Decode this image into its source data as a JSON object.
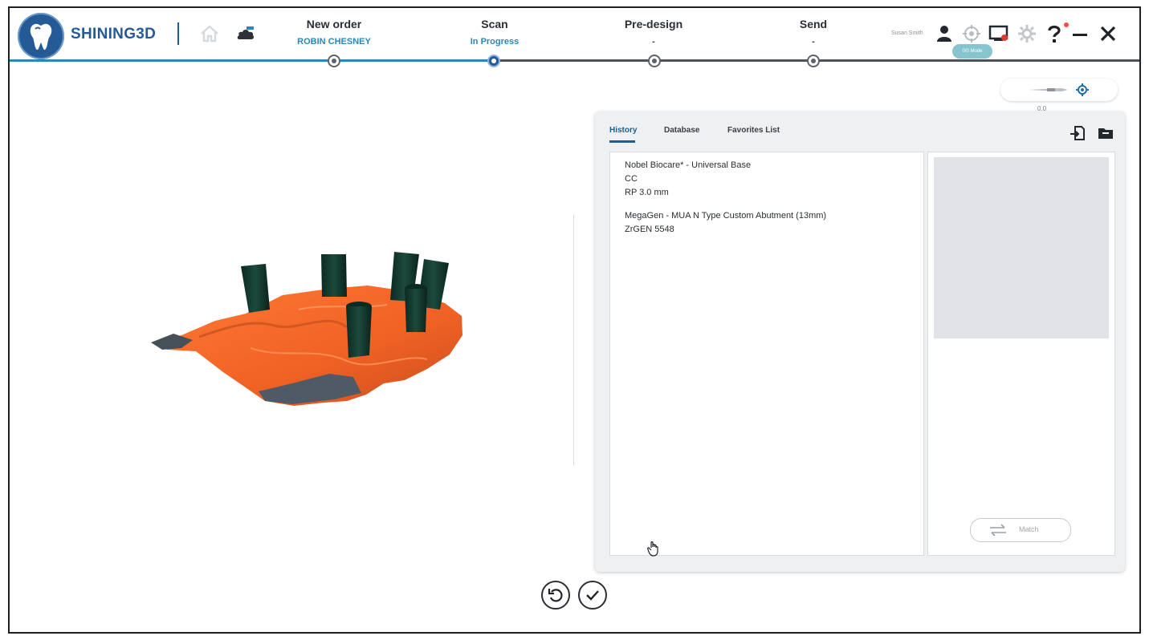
{
  "brand": {
    "name": "SHINING3D"
  },
  "workflow": {
    "steps": [
      {
        "label": "New order",
        "sub": "ROBIN CHESNEY"
      },
      {
        "label": "Scan",
        "sub": "In Progress"
      },
      {
        "label": "Pre-design",
        "sub": "-"
      },
      {
        "label": "Send",
        "sub": "-"
      }
    ]
  },
  "toolbar": {
    "user_name": "Susan Smith",
    "tooltip": "0/0 Mode"
  },
  "scan_pill": {
    "value": "0.0"
  },
  "panel": {
    "tabs": [
      "History",
      "Database",
      "Favorites List"
    ],
    "entries": [
      {
        "line1": "Nobel Biocare* - Universal Base",
        "line2": "CC",
        "line3": "RP 3.0 mm"
      },
      {
        "line1": "MegaGen - MUA N Type Custom Abutment (13mm)",
        "line2": "ZrGEN 5548"
      }
    ],
    "match_label": "Match"
  },
  "colors": {
    "brand_blue": "#245b97",
    "progress_blue": "#2b86b9",
    "scan_orange": "#f46a2c",
    "abutment_green": "#12392f"
  }
}
